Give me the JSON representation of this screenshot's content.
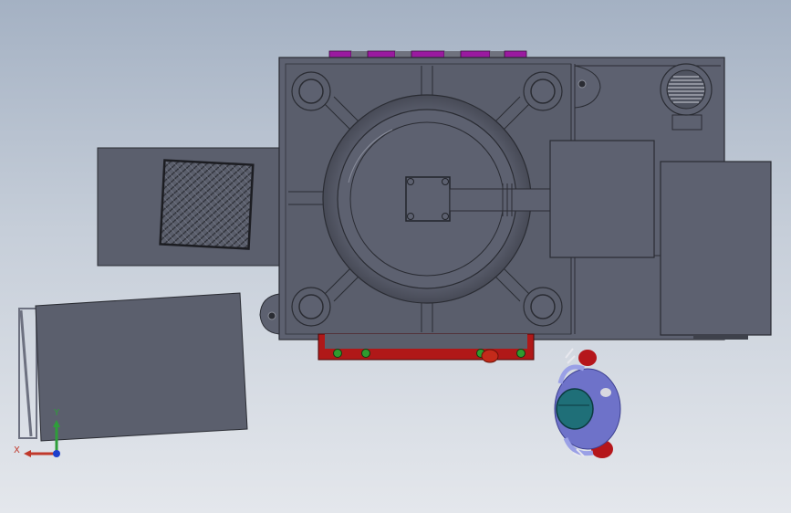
{
  "viewport": {
    "background_top": "#a4b1c3",
    "background_bottom": "#e4e7ec"
  },
  "colors": {
    "body": "#5d6170",
    "body_dark": "#4d515e",
    "edge": "#2a2c33",
    "purple_clamps": "#9a1aa0",
    "red_rail": "#b01818",
    "green_bolts": "#2f9c2f",
    "worker_body": "#6e72c9",
    "worker_helmet": "#1f6f78",
    "worker_red": "#b5161b"
  },
  "triad": {
    "x_label": "X",
    "y_label": "Y",
    "x_color": "#c0392b",
    "y_color": "#2e9e3a",
    "z_color": "#1e3fcc"
  },
  "components": {
    "main_frame": "machine-frame",
    "motor": "drive-motor",
    "fan": "cooling-fan",
    "control_box": "control-box",
    "feed_plate": "feed-plate",
    "side_cart": "side-cart",
    "operator": "operator"
  }
}
